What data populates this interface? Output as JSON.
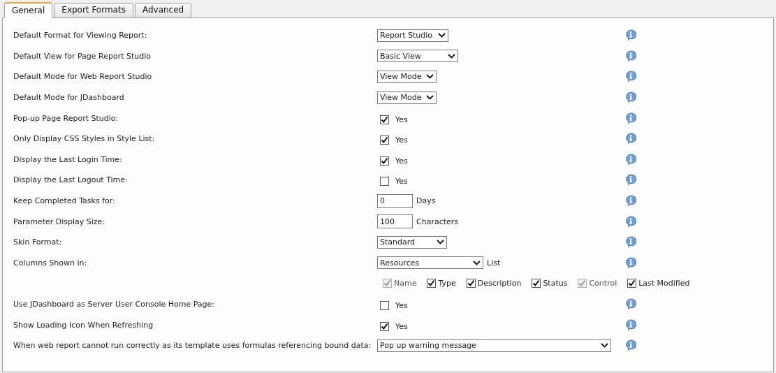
{
  "tabs": [
    {
      "label": "General",
      "selected": true
    },
    {
      "label": "Export Formats",
      "selected": false
    },
    {
      "label": "Advanced",
      "selected": false
    }
  ],
  "settings": [
    {
      "kind": "select",
      "label": "Default Format for Viewing Report:",
      "value": "Report Studio"
    },
    {
      "kind": "select",
      "label": "Default View for Page Report Studio",
      "value": "Basic View"
    },
    {
      "kind": "select",
      "label": "Default Mode for Web Report Studio",
      "value": "View Mode"
    },
    {
      "kind": "select",
      "label": "Default Mode for JDashboard",
      "value": "View Mode"
    },
    {
      "kind": "checkbox",
      "label": "Pop-up Page Report Studio:",
      "checked": true,
      "text": "Yes"
    },
    {
      "kind": "checkbox",
      "label": "Only Display CSS Styles in Style List:",
      "checked": true,
      "text": "Yes"
    },
    {
      "kind": "checkbox",
      "label": "Display the Last Login Time:",
      "checked": true,
      "text": "Yes"
    },
    {
      "kind": "checkbox",
      "label": "Display the Last Logout Time:",
      "checked": false,
      "text": "Yes"
    },
    {
      "kind": "number",
      "label": "Keep Completed Tasks for:",
      "value": "0",
      "unit": "Days"
    },
    {
      "kind": "number",
      "label": "Parameter Display Size:",
      "value": "100",
      "unit": "Characters"
    },
    {
      "kind": "select",
      "label": "Skin Format:",
      "value": "Standard"
    },
    {
      "kind": "select",
      "label": "Columns Shown in:",
      "value": "Resources",
      "unit": "List"
    },
    {
      "kind": "columns",
      "options": [
        {
          "text": "Name",
          "checked": true,
          "disabled": true
        },
        {
          "text": "Type",
          "checked": true,
          "disabled": false
        },
        {
          "text": "Description",
          "checked": true,
          "disabled": false
        },
        {
          "text": "Status",
          "checked": true,
          "disabled": false
        },
        {
          "text": "Control",
          "checked": true,
          "disabled": true
        },
        {
          "text": "Last Modified",
          "checked": true,
          "disabled": false
        }
      ]
    },
    {
      "kind": "checkbox",
      "label": "Use JDashboard as Server User Console Home Page:",
      "checked": false,
      "text": "Yes"
    },
    {
      "kind": "checkbox",
      "label": "Show Loading Icon When Refreshing",
      "checked": true,
      "text": "Yes"
    },
    {
      "kind": "select",
      "label": "When web report cannot run correctly as its template uses formulas referencing bound data:",
      "value": "Pop up warning message"
    }
  ]
}
